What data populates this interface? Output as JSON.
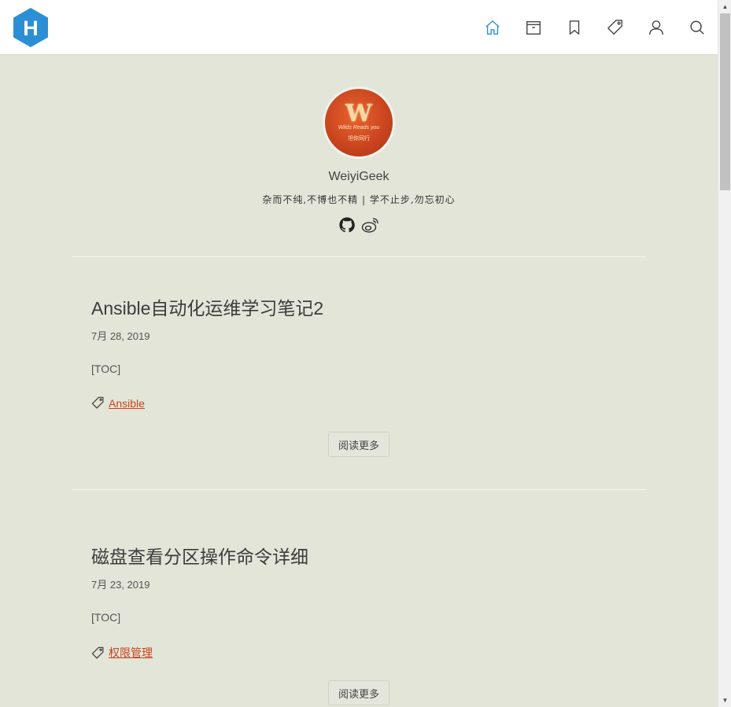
{
  "site": {
    "logo_letter": "H"
  },
  "nav": {
    "items": [
      {
        "name": "home",
        "icon": "home-icon",
        "active": true
      },
      {
        "name": "archive",
        "icon": "archive-icon"
      },
      {
        "name": "bookmark",
        "icon": "bookmark-icon"
      },
      {
        "name": "tags",
        "icon": "tag-icon"
      },
      {
        "name": "about",
        "icon": "user-icon"
      },
      {
        "name": "search",
        "icon": "search-icon"
      }
    ]
  },
  "profile": {
    "avatar_letter": "W",
    "avatar_line1": "Wilds Reads you",
    "avatar_line2": "坦你同行",
    "name": "WeiyiGeek",
    "motto": "杂而不纯,不博也不精 | 学不止步,勿忘初心",
    "social": [
      {
        "icon": "github-icon"
      },
      {
        "icon": "weibo-icon"
      }
    ]
  },
  "posts": [
    {
      "title": "Ansible自动化运维学习笔记2",
      "date": "7月 28, 2019",
      "excerpt": "[TOC]",
      "tag": "Ansible",
      "read_more": "阅读更多"
    },
    {
      "title": "磁盘查看分区操作命令详细",
      "date": "7月 23, 2019",
      "excerpt": "[TOC]",
      "tag": "权限管理",
      "read_more": "阅读更多"
    }
  ],
  "colors": {
    "accent": "#c7441b",
    "background": "#e2e5d8",
    "logo": "#2b8fd6"
  }
}
